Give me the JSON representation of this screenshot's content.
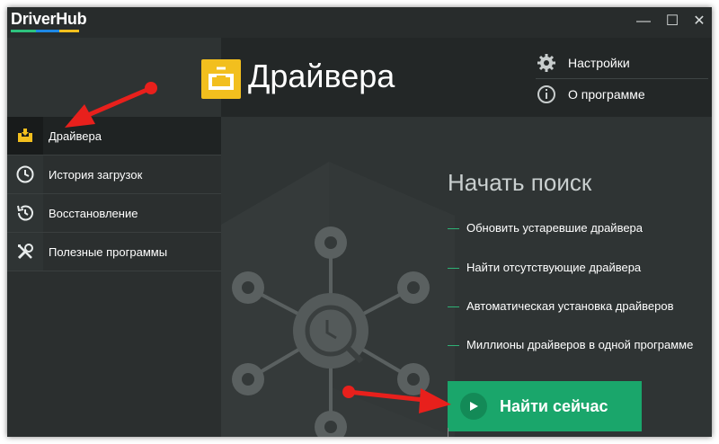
{
  "app": {
    "title": "DriverHub",
    "colors": [
      "#2ec27e",
      "#1e88e5",
      "#f2bf1e"
    ]
  },
  "window_controls": {
    "minimize": "—",
    "maximize": "☐",
    "close": "✕"
  },
  "page": {
    "title": "Драйвера"
  },
  "top_menu": [
    {
      "label": "Настройки",
      "icon": "gear-icon"
    },
    {
      "label": "О программе",
      "icon": "info-icon"
    }
  ],
  "sidebar": {
    "items": [
      {
        "label": "Драйвера",
        "icon": "drivers-tray-icon",
        "active": true
      },
      {
        "label": "История загрузок",
        "icon": "clock-icon",
        "active": false
      },
      {
        "label": "Восстановление",
        "icon": "history-restore-icon",
        "active": false
      },
      {
        "label": "Полезные программы",
        "icon": "tools-icon",
        "active": false
      }
    ]
  },
  "main": {
    "heading": "Начать поиск",
    "features": [
      "Обновить устаревшие драйвера",
      "Найти отсутствующие драйвера",
      "Автоматическая установка драйверов",
      "Миллионы драйверов в одной программе"
    ],
    "cta_label": "Найти сейчас"
  },
  "theme": {
    "accent": "#1aa66b",
    "icon_yellow": "#f2bf1e",
    "annotation_red": "#e8201c"
  }
}
